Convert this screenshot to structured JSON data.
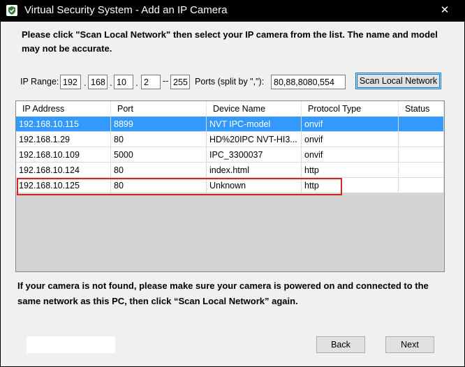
{
  "window": {
    "title": "Virtual Security System - Add an IP Camera",
    "close_glyph": "✕"
  },
  "instruction": "Please click \"Scan Local Network\" then select your IP camera from the list. The name and model may not be accurate.",
  "ip_range": {
    "label": "IP Range:",
    "octets": [
      "192",
      "168",
      "10",
      "2"
    ],
    "dot": ".",
    "dash": "--",
    "end": "255",
    "ports_label": "Ports (split by \",\"):",
    "ports": "80,88,8080,554"
  },
  "scan_button": "Scan Local Network",
  "table": {
    "columns": [
      "IP Address",
      "Port",
      "Device Name",
      "Protocol Type",
      "Status"
    ],
    "rows": [
      {
        "ip": "192.168.10.115",
        "port": "8899",
        "name": "NVT IPC-model",
        "protocol": "onvif",
        "status": "",
        "selected": true
      },
      {
        "ip": "192.168.1.29",
        "port": "80",
        "name": "HD%20IPC NVT-HI3...",
        "protocol": "onvif",
        "status": ""
      },
      {
        "ip": "192.168.10.109",
        "port": "5000",
        "name": "IPC_3300037",
        "protocol": "onvif",
        "status": ""
      },
      {
        "ip": "192.168.10.124",
        "port": "80",
        "name": "index.html",
        "protocol": "http",
        "status": ""
      },
      {
        "ip": "192.168.10.125",
        "port": "80",
        "name": "Unknown",
        "protocol": "http",
        "status": "",
        "highlighted": true
      }
    ]
  },
  "footnote": "If your camera is not found, please make sure your camera is powered on and connected to the same network as this PC, then click “Scan Local Network” again.",
  "buttons": {
    "back": "Back",
    "next": "Next"
  },
  "colors": {
    "selection": "#3399ff",
    "highlight_border": "#e02020",
    "focus_border": "#0078d7"
  },
  "icons": {
    "app": "shield-icon",
    "close": "close-icon"
  }
}
